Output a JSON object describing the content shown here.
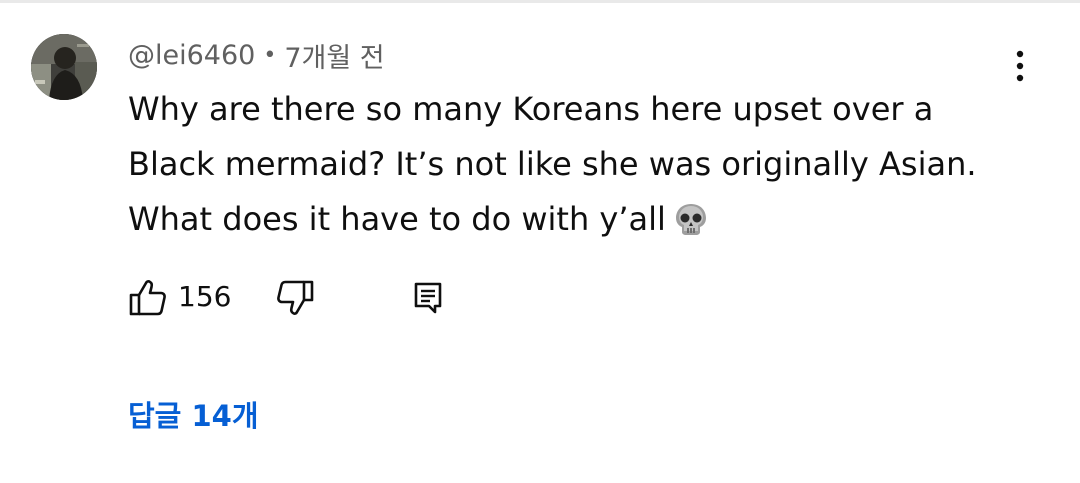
{
  "comment": {
    "author": "@lei6460",
    "separator": "•",
    "time": "7개월 전",
    "text_lines": [
      "Why are there so many Koreans here upset over a",
      "Black mermaid? It’s not like she was originally Asian.",
      "What does it have to do with y’all"
    ],
    "emoji": "skull-emoji",
    "like_count": "156",
    "replies_label": "답글 14개"
  },
  "icons": {
    "like": "thumbs-up-icon",
    "dislike": "thumbs-down-icon",
    "reply": "comment-reply-icon",
    "menu": "more-vertical-icon"
  },
  "colors": {
    "text": "#0f0f0f",
    "secondary_text": "#606060",
    "link": "#065fd4",
    "background": "#ffffff"
  }
}
